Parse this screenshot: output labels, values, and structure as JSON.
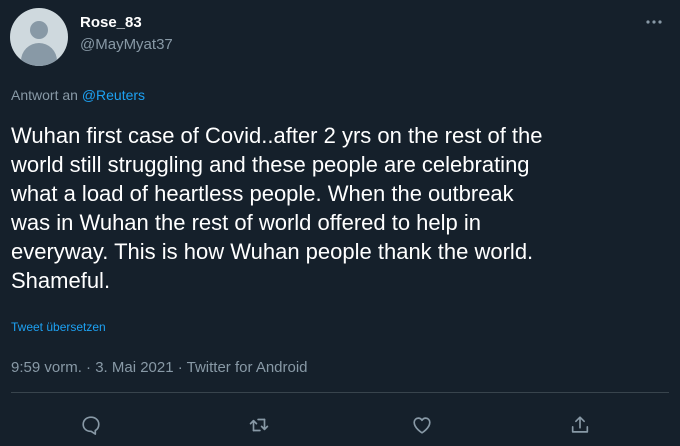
{
  "user": {
    "display_name": "Rose_83",
    "handle": "@MayMyat37"
  },
  "reply": {
    "prefix": "Antwort an",
    "mention": "@Reuters"
  },
  "tweet": {
    "text": "Wuhan first case of Covid..after 2 yrs on the rest of the\nworld still struggling and these people are celebrating\nwhat a load of heartless people. When the outbreak\nwas in Wuhan the rest of world offered to help in\neveryway. This is how Wuhan people thank the world.\nShameful.",
    "translate_label": "Tweet übersetzen",
    "meta": "9:59 vorm. · 3. Mai 2021 · Twitter for Android"
  },
  "actions": [
    {
      "icon": "reply-icon"
    },
    {
      "icon": "retweet-icon"
    },
    {
      "icon": "like-icon"
    },
    {
      "icon": "share-icon"
    }
  ],
  "colors": {
    "background": "#15202b",
    "text": "#ffffff",
    "secondary": "#8899a6",
    "accent": "#1da1f2",
    "divider": "#38444d"
  }
}
